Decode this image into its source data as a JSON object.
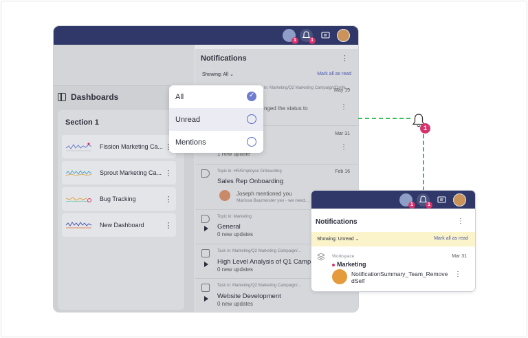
{
  "notifications_panel": {
    "title": "Notifications",
    "showing_label": "Showing: All",
    "mark_all_label": "Mark all as read"
  },
  "sidebar": {
    "title": "Dashboards",
    "section_title": "Section 1",
    "items": [
      {
        "label": "Fission Marketing Ca..."
      },
      {
        "label": "Sprout Marketing Ca..."
      },
      {
        "label": "Bug Tracking"
      },
      {
        "label": "New Dashboard"
      }
    ]
  },
  "filter_dropdown": {
    "options": [
      {
        "label": "All",
        "checked": true
      },
      {
        "label": "Unread",
        "checked": false
      },
      {
        "label": "Mentions",
        "checked": false
      }
    ]
  },
  "notifications": [
    {
      "context": "in: Marketing/Q2 Marketing Campaign/Confe...",
      "date": "May 19",
      "title": "",
      "sub": "nged the status to"
    },
    {
      "context": "",
      "date": "Mar 31",
      "title": "",
      "sub": "1 new update"
    },
    {
      "context": "Topic in: HR/Employee Onboarding",
      "date": "Feb 16",
      "title": "Sales Rep Onboarding",
      "sub": "Joseph mentioned you",
      "sub2": "Marissa Baumeister yes - we need..."
    },
    {
      "context": "Topic in: Marketing",
      "date": "",
      "title": "General",
      "sub": "0 new updates"
    },
    {
      "context": "Task in: Marketing/Q2 Marketing Campaign/...",
      "date": "",
      "title": "High Level Analysis of Q1 Campa...",
      "sub": "0 new updates"
    },
    {
      "context": "Task in: Marketing/Q2 Marketing Campaign/...",
      "date": "",
      "title": "Website Development",
      "sub": "0 new updates"
    }
  ],
  "popup": {
    "title": "Notifications",
    "showing_label": "Showing: Unread",
    "mark_all_label": "Mark all as read",
    "context": "Workspace",
    "date": "Mar 31",
    "name": "Marketing",
    "message": "NotificationSummary_Team_RemovedSelf"
  },
  "badges": {
    "bell": "1"
  },
  "colors": {
    "topbar": "#2f3868",
    "accent": "#5b6ac4",
    "badge": "#d6336c",
    "connector": "#3bbf5a",
    "highlight_band": "#fbf3c9"
  }
}
